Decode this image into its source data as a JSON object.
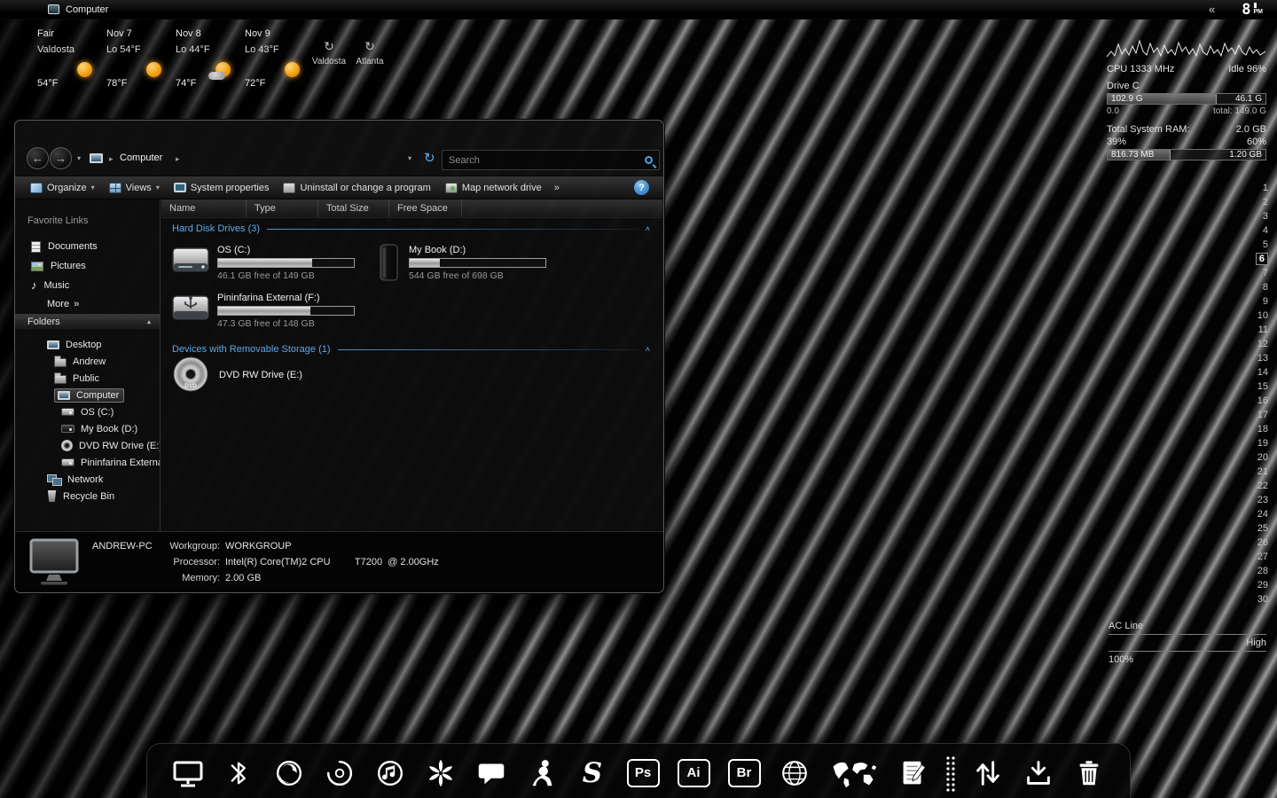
{
  "glyphs": {
    "chev_right": "▸",
    "caret": "▾",
    "collapse_up": "˄",
    "back": "←",
    "forward": "→",
    "refresh": "↻"
  },
  "taskbar": {
    "title": "Computer",
    "collapse": "«",
    "clock_hour": "8",
    "clock_ampm": "PM"
  },
  "weather": {
    "current": {
      "line1": "Fair",
      "line2": "Valdosta",
      "temp": "54°F",
      "icon": "sunny"
    },
    "days": [
      {
        "line1": "Nov 7",
        "line2": "Lo 54°F",
        "temp": "78°F",
        "icon": "sunny"
      },
      {
        "line1": "Nov 8",
        "line2": "Lo 44°F",
        "temp": "74°F",
        "icon": "partly-cloudy"
      },
      {
        "line1": "Nov 9",
        "line2": "Lo 43°F",
        "temp": "72°F",
        "icon": "sunny"
      }
    ],
    "stations": [
      {
        "label": "Valdosta"
      },
      {
        "label": "Atlanta"
      }
    ]
  },
  "sysmon": {
    "cpu_label": "CPU 1333 MHz",
    "cpu_idle": "Idle 96%",
    "drive_label": "Drive C",
    "drive_used": "102.9 G",
    "drive_free": "46.1 G",
    "drive_zero": "0.0",
    "drive_total": "total: 149.0 G",
    "drive_fill_pct": 69,
    "ram_label": "Total System RAM:",
    "ram_total": "2.0 GB",
    "ram_pct_used": "39%",
    "ram_pct_free": "60%",
    "ram_used": "816.73 MB",
    "ram_free": "1.20 GB",
    "ram_fill_pct": 40
  },
  "calendar": {
    "days": [
      "1",
      "2",
      "3",
      "4",
      "5",
      "6",
      "7",
      "8",
      "9",
      "10",
      "11",
      "12",
      "13",
      "14",
      "15",
      "16",
      "17",
      "18",
      "19",
      "20",
      "21",
      "22",
      "23",
      "24",
      "25",
      "26",
      "27",
      "28",
      "29",
      "30"
    ],
    "selected": "6"
  },
  "power": {
    "label": "AC Line",
    "level": "High",
    "percent": "100%"
  },
  "explorer": {
    "nav": {
      "breadcrumb": "Computer",
      "search_placeholder": "Search"
    },
    "toolbar": {
      "organize": "Organize",
      "views": "Views",
      "system_properties": "System properties",
      "uninstall": "Uninstall or change a program",
      "map_drive": "Map network drive",
      "overflow": "»",
      "help": "?"
    },
    "columns": [
      {
        "label": "Name"
      },
      {
        "label": "Type"
      },
      {
        "label": "Total Size"
      },
      {
        "label": "Free Space"
      }
    ],
    "groups": [
      {
        "label": "Hard Disk Drives (3)"
      },
      {
        "label": "Devices with Removable Storage (1)"
      }
    ],
    "drives": [
      {
        "name": "OS (C:)",
        "free": "46.1 GB free of 149 GB",
        "used_pct": 69
      },
      {
        "name": "My Book (D:)",
        "free": "544 GB free of 698 GB",
        "used_pct": 22
      },
      {
        "name": "Pininfarina External (F:)",
        "free": "47.3 GB free of 148 GB",
        "used_pct": 68
      }
    ],
    "removable": [
      {
        "name": "DVD RW Drive (E:)",
        "disc_label": "DVD"
      }
    ],
    "sidebar": {
      "favorites_header": "Favorite Links",
      "favorites": [
        {
          "label": "Documents"
        },
        {
          "label": "Pictures"
        },
        {
          "label": "Music"
        }
      ],
      "more_label": "More",
      "more_chevron": "»",
      "folders_header": "Folders",
      "tree": [
        {
          "label": "Desktop"
        },
        {
          "label": "Andrew"
        },
        {
          "label": "Public"
        },
        {
          "label": "Computer"
        },
        {
          "label": "OS (C:)"
        },
        {
          "label": "My Book (D:)"
        },
        {
          "label": "DVD RW Drive (E:)"
        },
        {
          "label": "Pininfarina Externa"
        },
        {
          "label": "Network"
        },
        {
          "label": "Recycle Bin"
        }
      ]
    },
    "details": {
      "computer": "ANDREW-PC",
      "rows": [
        {
          "label": "Workgroup:",
          "value": "WORKGROUP"
        },
        {
          "label": "Processor:",
          "value": "Intel(R) Core(TM)2 CPU         T7200  @ 2.00GHz"
        },
        {
          "label": "Memory:",
          "value": "2.00 GB"
        }
      ]
    }
  },
  "dock": {
    "photoshop_label": "Ps",
    "illustrator_label": "Ai",
    "bridge_label": "Br",
    "s_label": "S"
  },
  "colors": {
    "accent_blue": "#5fa8e8",
    "sun_orange": "#f29d09"
  }
}
